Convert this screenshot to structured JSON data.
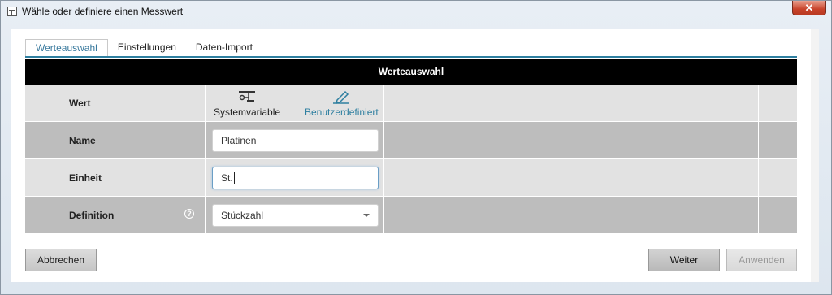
{
  "window": {
    "title": "Wähle oder definiere einen Messwert",
    "close_label": "✕"
  },
  "tabs": [
    {
      "label": "Werteauswahl",
      "active": true
    },
    {
      "label": "Einstellungen",
      "active": false
    },
    {
      "label": "Daten-Import",
      "active": false
    }
  ],
  "section_title": "Werteauswahl",
  "rows": {
    "wert": {
      "label": "Wert",
      "option_system": {
        "label": "Systemvariable",
        "icon": "system-variable-icon"
      },
      "option_user": {
        "label": "Benutzerdefiniert",
        "icon": "edit-pencil-icon",
        "selected": true
      }
    },
    "name": {
      "label": "Name",
      "value": "Platinen"
    },
    "einheit": {
      "label": "Einheit",
      "value": "St."
    },
    "definition": {
      "label": "Definition",
      "help": "?",
      "selected": "Stückzahl"
    }
  },
  "buttons": {
    "cancel": "Abbrechen",
    "next": "Weiter",
    "apply": "Anwenden"
  },
  "colors": {
    "accent": "#2e7fa0",
    "header_bg": "#000000",
    "close": "#c8432a"
  }
}
